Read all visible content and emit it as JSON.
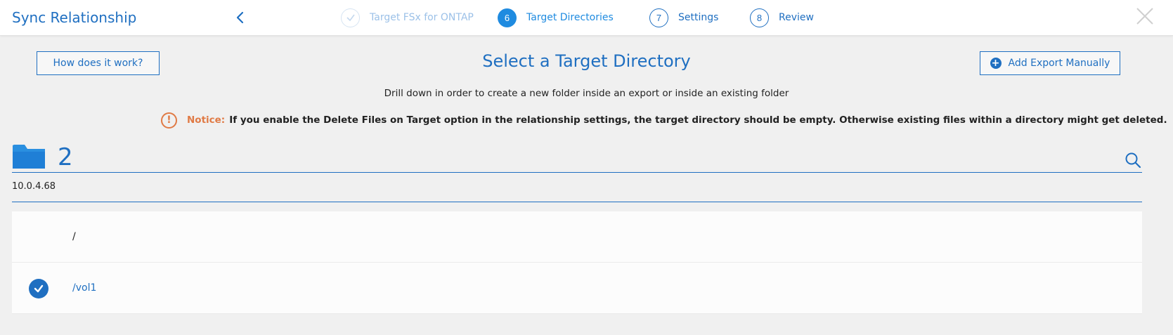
{
  "header": {
    "title": "Sync Relationship",
    "steps": [
      {
        "number": "✓",
        "label": "Target FSx for ONTAP",
        "state": "done"
      },
      {
        "number": "6",
        "label": "Target Directories",
        "state": "active"
      },
      {
        "number": "7",
        "label": "Settings",
        "state": "todo"
      },
      {
        "number": "8",
        "label": "Review",
        "state": "todo"
      }
    ]
  },
  "main": {
    "how_button": "How does it work?",
    "page_title": "Select a Target Directory",
    "add_export_button": "Add Export Manually",
    "subtitle": "Drill down in order to create a new folder inside an export or inside an existing folder",
    "notice": {
      "label": "Notice:",
      "text": "If you enable the Delete Files on Target option in the relationship settings, the target directory should be empty. Otherwise existing files within a directory might get deleted."
    },
    "folder_count": "2",
    "current_path": "10.0.4.68",
    "directories": [
      {
        "name": "/",
        "selected": false
      },
      {
        "name": "/vol1",
        "selected": true
      }
    ]
  },
  "colors": {
    "accent": "#1f6fc1",
    "active_step": "#1f8be0",
    "notice": "#e07a45",
    "background": "#f0f0f0"
  },
  "icons": [
    "chevron-left-icon",
    "check-icon",
    "close-icon",
    "plus-circle-icon",
    "exclamation-circle-icon",
    "folder-icon",
    "search-icon"
  ]
}
